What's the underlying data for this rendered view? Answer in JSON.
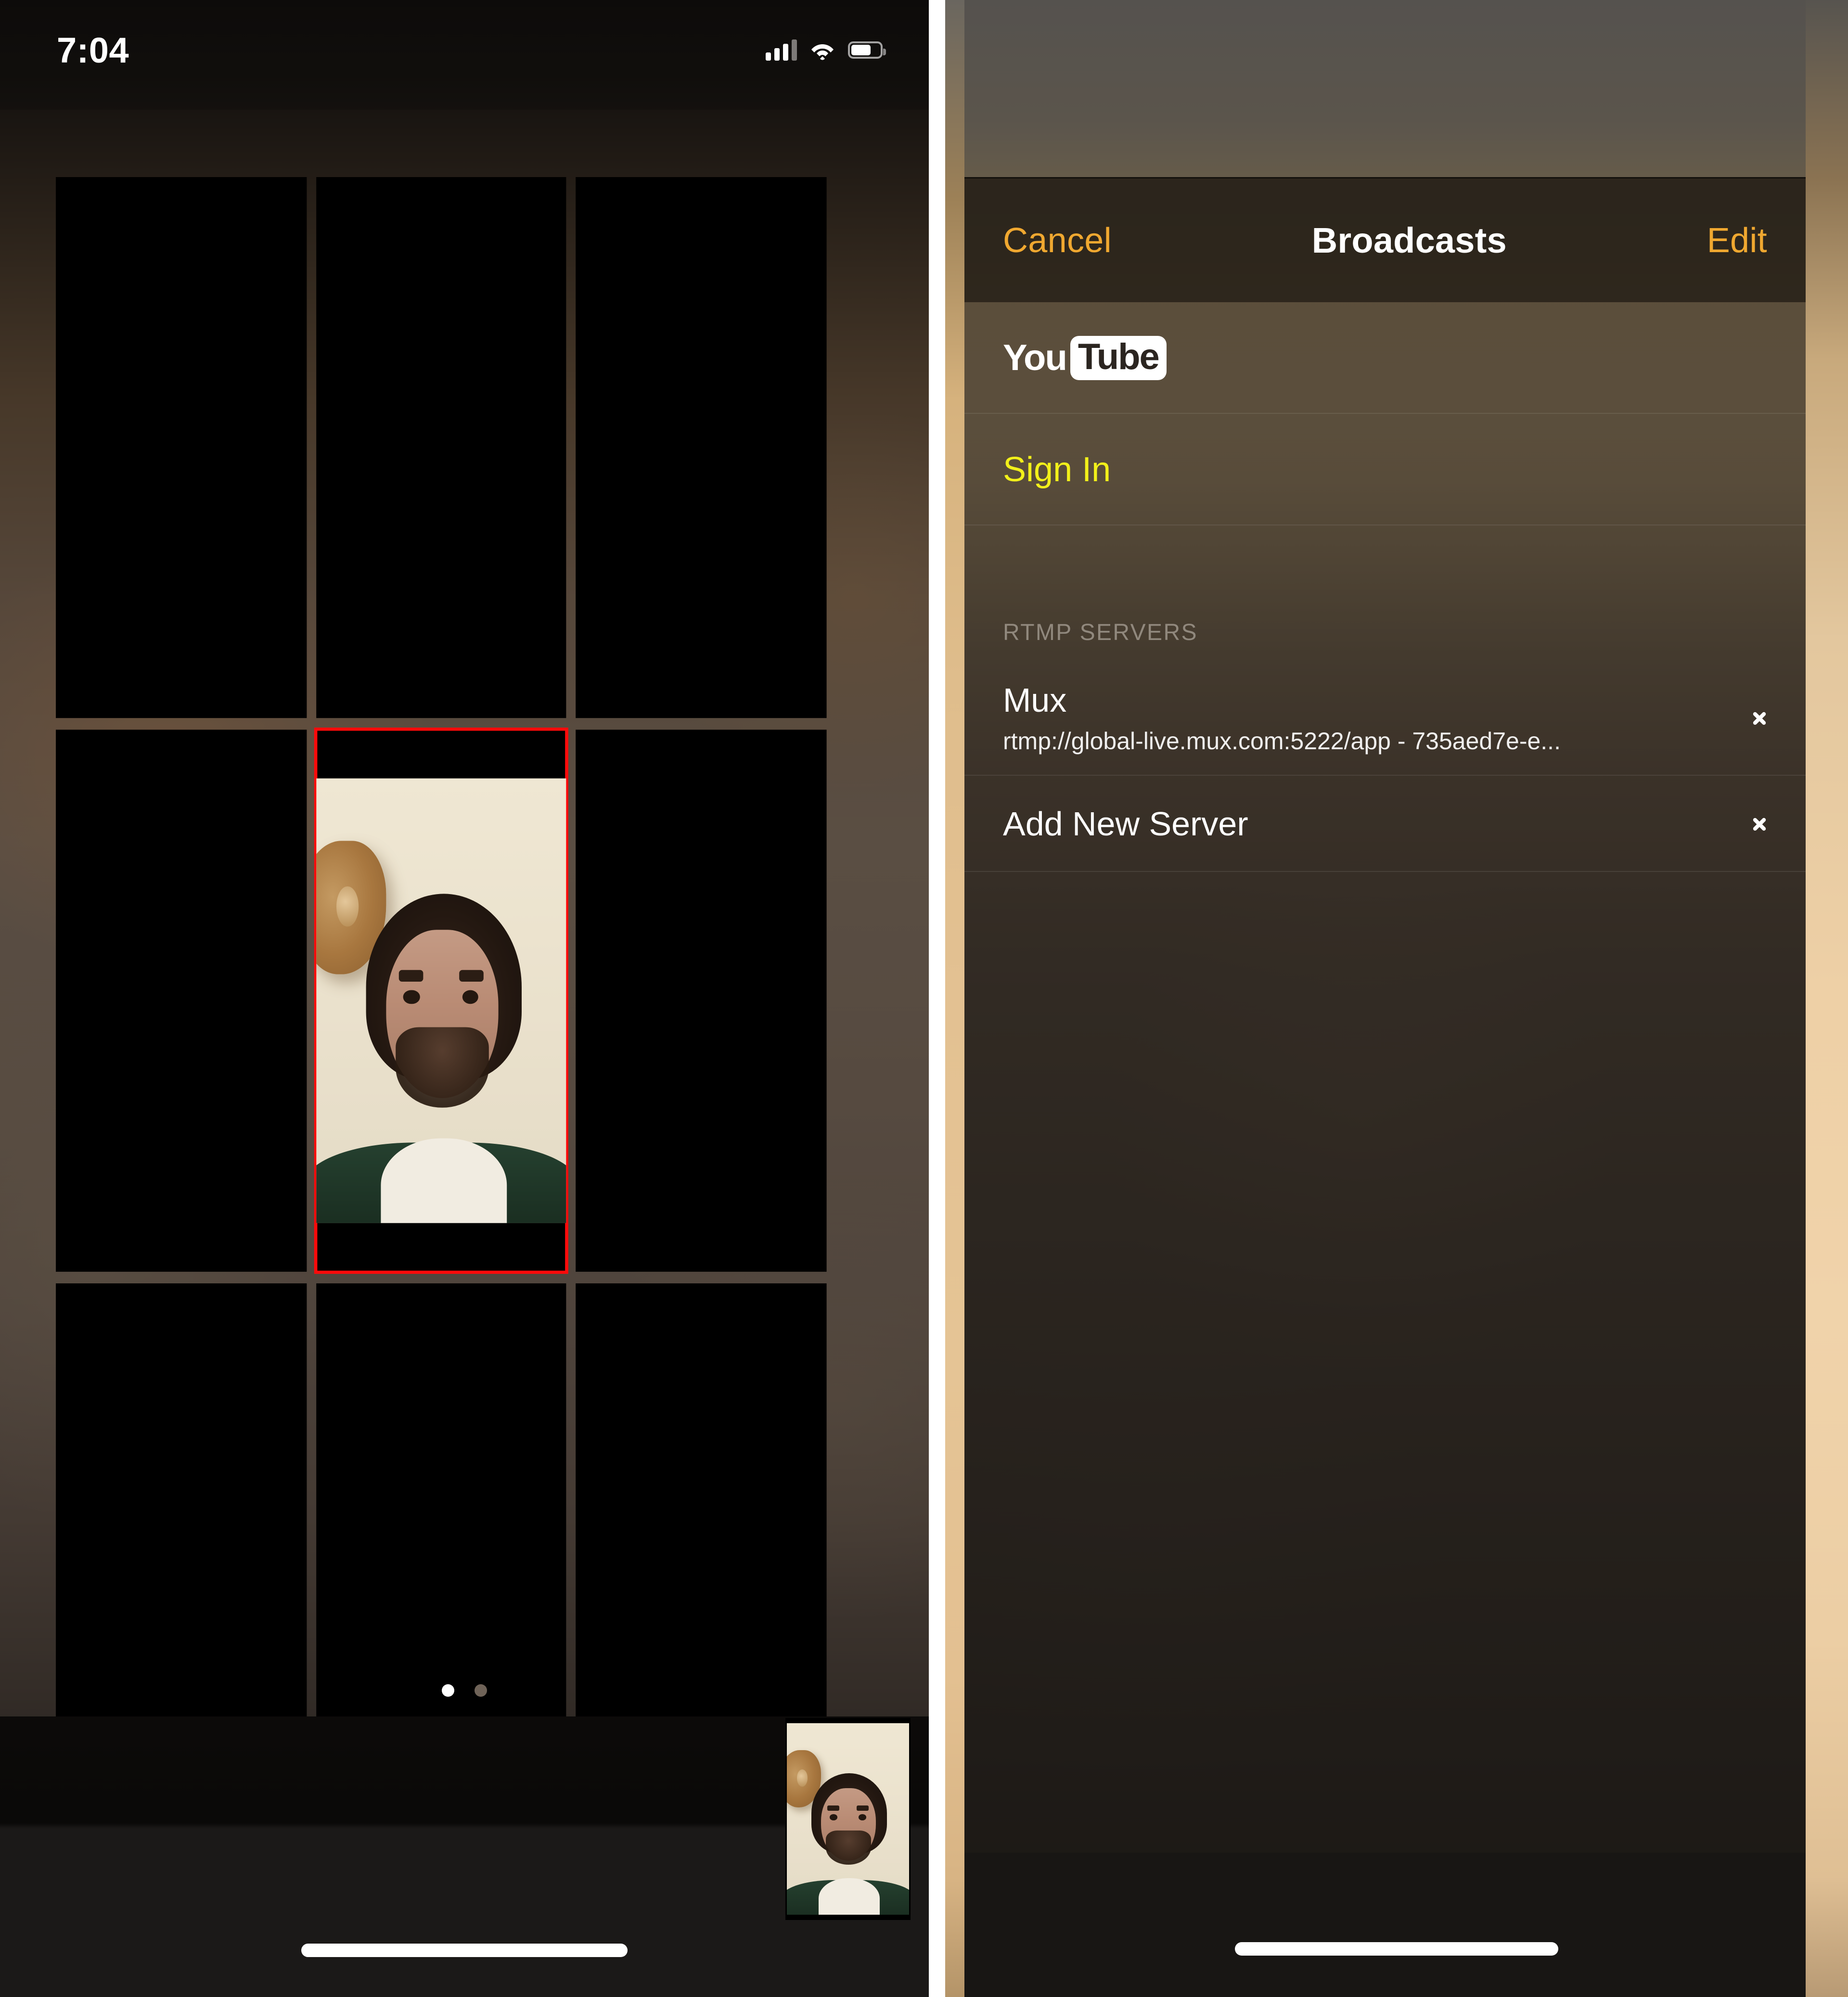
{
  "left_screen": {
    "status_bar": {
      "time": "7:04",
      "cellular_icon": "cellular-signal-icon",
      "wifi_icon": "wifi-icon",
      "battery_icon": "battery-icon"
    },
    "video_grid": {
      "rows": 3,
      "columns": 3,
      "tiles": [
        {
          "index": 1,
          "state": "empty",
          "selected": false
        },
        {
          "index": 2,
          "state": "empty",
          "selected": false
        },
        {
          "index": 3,
          "state": "empty",
          "selected": false
        },
        {
          "index": 4,
          "state": "empty",
          "selected": false
        },
        {
          "index": 5,
          "state": "live-camera",
          "selected": true
        },
        {
          "index": 6,
          "state": "empty",
          "selected": false
        },
        {
          "index": 7,
          "state": "empty",
          "selected": false
        },
        {
          "index": 8,
          "state": "empty",
          "selected": false
        },
        {
          "index": 9,
          "state": "empty",
          "selected": false
        }
      ],
      "selection_color": "#ff0a0a"
    },
    "page_indicator": {
      "total_pages": 2,
      "current_page": 1,
      "active_color": "#ffffff",
      "inactive_color": "#6f6358"
    },
    "picture_in_picture": {
      "label": "camera-preview",
      "state": "live-camera"
    },
    "home_indicator": "home-indicator"
  },
  "right_screen": {
    "nav_bar": {
      "cancel_label": "Cancel",
      "title": "Broadcasts",
      "edit_label": "Edit",
      "accent_color": "#f0a830"
    },
    "youtube_row": {
      "logo_you": "You",
      "logo_tube": "Tube"
    },
    "signin_row": {
      "label": "Sign In",
      "color": "#f2f01a"
    },
    "rtmp_section": {
      "header": "RTMP SERVERS",
      "servers": [
        {
          "name": "Mux",
          "url": "rtmp://global-live.mux.com:5222/app - 735aed7e-e...",
          "chevron": "chevron-right-icon"
        }
      ],
      "add_new": {
        "label": "Add New Server",
        "chevron": "chevron-right-icon"
      }
    },
    "home_indicator": "home-indicator"
  }
}
